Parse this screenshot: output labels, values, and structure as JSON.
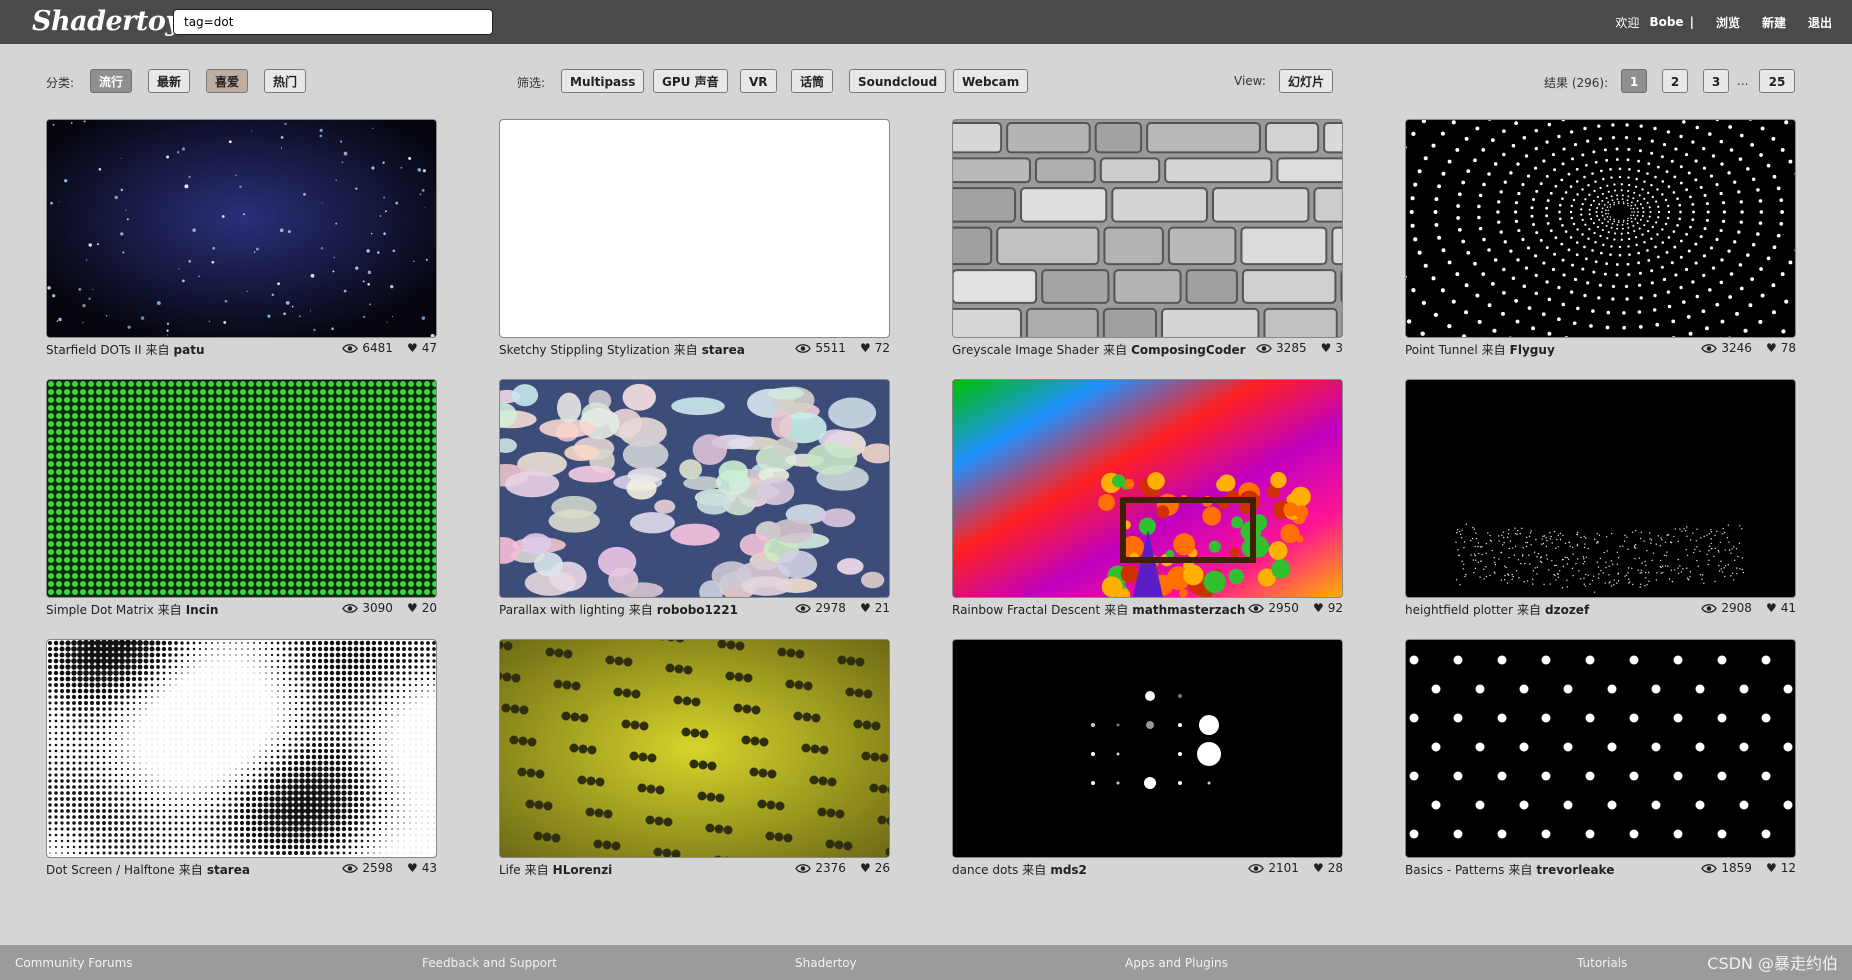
{
  "header": {
    "logo": "Shadertoy",
    "search_value": "tag=dot",
    "welcome": "欢迎",
    "user": "Bobe",
    "separator": "|",
    "browse": "浏览",
    "new": "新建",
    "logout": "退出"
  },
  "filters": {
    "sort_label": "分类:",
    "sort_options": [
      "流行",
      "最新",
      "喜爱",
      "热门"
    ],
    "filter_label": "筛选:",
    "filter_options": [
      "Multipass",
      "GPU 声音",
      "VR",
      "话筒",
      "Soundcloud",
      "Webcam"
    ],
    "view_label": "View:",
    "view_option": "幻灯片",
    "results_label": "结果 (296):",
    "pages": [
      "1",
      "2",
      "3",
      "25"
    ],
    "ellipsis": "..."
  },
  "shaders": [
    {
      "title": "Starfield DOTs II",
      "from": "来自",
      "author": "patu",
      "views": "6481",
      "likes": "47"
    },
    {
      "title": "Sketchy Stippling Stylization",
      "from": "来自",
      "author": "starea",
      "views": "5511",
      "likes": "72"
    },
    {
      "title": "Greyscale Image Shader",
      "from": "来自",
      "author": "ComposingCoder",
      "views": "3285",
      "likes": "3"
    },
    {
      "title": "Point Tunnel",
      "from": "来自",
      "author": "Flyguy",
      "views": "3246",
      "likes": "78"
    },
    {
      "title": "Simple Dot Matrix",
      "from": "来自",
      "author": "Incin",
      "views": "3090",
      "likes": "20"
    },
    {
      "title": "Parallax with lighting",
      "from": "来自",
      "author": "robobo1221",
      "views": "2978",
      "likes": "21"
    },
    {
      "title": "Rainbow Fractal Descent",
      "from": "来自",
      "author": "mathmasterzach",
      "views": "2950",
      "likes": "92"
    },
    {
      "title": "heightfield plotter",
      "from": "来自",
      "author": "dzozef",
      "views": "2908",
      "likes": "41"
    },
    {
      "title": "Dot Screen / Halftone",
      "from": "来自",
      "author": "starea",
      "views": "2598",
      "likes": "43"
    },
    {
      "title": "Life",
      "from": "来自",
      "author": "HLorenzi",
      "views": "2376",
      "likes": "26"
    },
    {
      "title": "dance dots",
      "from": "来自",
      "author": "mds2",
      "views": "2101",
      "likes": "28"
    },
    {
      "title": "Basics - Patterns",
      "from": "来自",
      "author": "trevorleake",
      "views": "1859",
      "likes": "12"
    }
  ],
  "footer": {
    "links": [
      "Community Forums",
      "Feedback and Support",
      "Shadertoy",
      "Apps and Plugins",
      "Tutorials"
    ],
    "watermark": "CSDN @暴走约伯"
  }
}
